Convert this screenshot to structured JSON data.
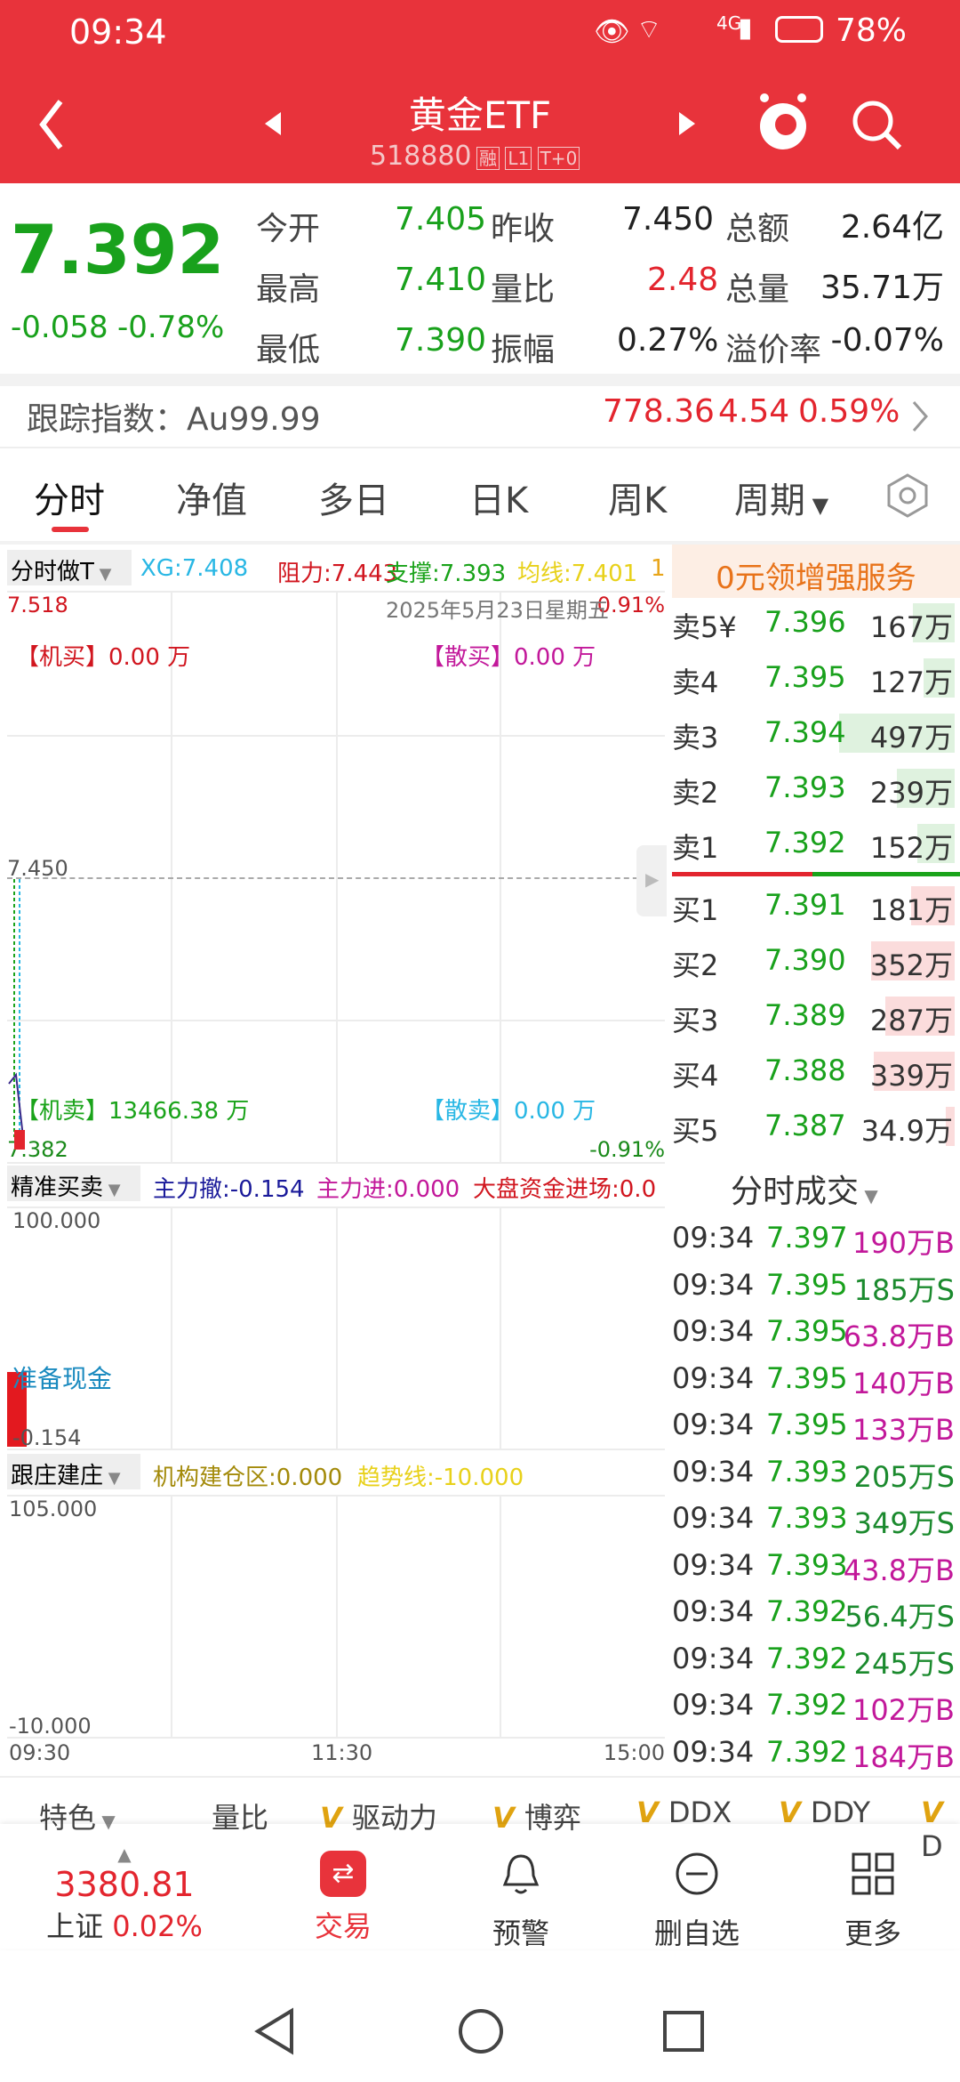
{
  "status": {
    "time": "09:34",
    "battery": "78%",
    "network": "4G"
  },
  "header": {
    "title": "黄金ETF",
    "code": "518880",
    "badges": [
      "融",
      "L1",
      "T+0"
    ]
  },
  "quote": {
    "price": "7.392",
    "change": "-0.058",
    "change_pct": "-0.78%",
    "open_label": "今开",
    "open": "7.405",
    "prev_label": "昨收",
    "prev": "7.450",
    "amount_label": "总额",
    "amount": "2.64亿",
    "high_label": "最高",
    "high": "7.410",
    "vr_label": "量比",
    "vr": "2.48",
    "vol_label": "总量",
    "vol": "35.71万",
    "low_label": "最低",
    "low": "7.390",
    "amp_label": "振幅",
    "amp": "0.27%",
    "prem_label": "溢价率",
    "prem": "-0.07%"
  },
  "track": {
    "label": "跟踪指数：Au99.99",
    "value": "778.36",
    "chg": "4.54",
    "pct": "0.59%"
  },
  "tabs": [
    "分时",
    "净值",
    "多日",
    "日K",
    "周K",
    "周期"
  ],
  "chart1": {
    "mode": "分时做T",
    "xg": "XG:7.408",
    "resist": "阻力:7.443",
    "support": "支撑:7.393",
    "avg": "均线:7.401",
    "extra": "1",
    "top": "7.518",
    "top_pct": "0.91%",
    "mid": "7.450",
    "bottom": "7.382",
    "bottom_pct": "-0.91%",
    "date": "2025年5月23日星期五",
    "inst_buy": "【机买】0.00 万",
    "ret_buy": "【散买】0.00 万",
    "inst_sell": "【机卖】13466.38 万",
    "ret_sell": "【散卖】0.00 万"
  },
  "chart2": {
    "mode": "精准买卖",
    "a": "主力撤:-0.154",
    "b": "主力进:0.000",
    "c": "大盘资金进场:0.0",
    "top": "100.000",
    "bottom": "-0.154",
    "note": "准备现金"
  },
  "chart3": {
    "mode": "跟庄建庄",
    "a": "机构建仓区:0.000",
    "b": "趋势线:-10.000",
    "top": "105.000",
    "bottom": "-10.000",
    "times": [
      "09:30",
      "11:30",
      "15:00"
    ]
  },
  "promo": "0元领增强服务",
  "orderbook": {
    "asks": [
      {
        "label": "卖5¥",
        "price": "7.396",
        "vol": "167万",
        "fill": 0.36
      },
      {
        "label": "卖4",
        "price": "7.395",
        "vol": "127万",
        "fill": 0.27
      },
      {
        "label": "卖3",
        "price": "7.394",
        "vol": "497万",
        "fill": 1.0
      },
      {
        "label": "卖2",
        "price": "7.393",
        "vol": "239万",
        "fill": 0.5
      },
      {
        "label": "卖1",
        "price": "7.392",
        "vol": "152万",
        "fill": 0.32
      }
    ],
    "bids": [
      {
        "label": "买1",
        "price": "7.391",
        "vol": "181万",
        "fill": 0.38
      },
      {
        "label": "买2",
        "price": "7.390",
        "vol": "352万",
        "fill": 0.72
      },
      {
        "label": "买3",
        "price": "7.389",
        "vol": "287万",
        "fill": 0.6
      },
      {
        "label": "买4",
        "price": "7.388",
        "vol": "339万",
        "fill": 0.7
      },
      {
        "label": "买5",
        "price": "7.387",
        "vol": "34.9万",
        "fill": 0.08
      }
    ]
  },
  "ticks_title": "分时成交",
  "ticks": [
    {
      "time": "09:34",
      "price": "7.397",
      "vol": "190万B",
      "side": "B"
    },
    {
      "time": "09:34",
      "price": "7.395",
      "vol": "185万S",
      "side": "S"
    },
    {
      "time": "09:34",
      "price": "7.395",
      "vol": "63.8万B",
      "side": "B"
    },
    {
      "time": "09:34",
      "price": "7.395",
      "vol": "140万B",
      "side": "B"
    },
    {
      "time": "09:34",
      "price": "7.395",
      "vol": "133万B",
      "side": "B"
    },
    {
      "time": "09:34",
      "price": "7.393",
      "vol": "205万S",
      "side": "S"
    },
    {
      "time": "09:34",
      "price": "7.393",
      "vol": "349万S",
      "side": "S"
    },
    {
      "time": "09:34",
      "price": "7.393",
      "vol": "43.8万B",
      "side": "B"
    },
    {
      "time": "09:34",
      "price": "7.392",
      "vol": "56.4万S",
      "side": "S"
    },
    {
      "time": "09:34",
      "price": "7.392",
      "vol": "245万S",
      "side": "S"
    },
    {
      "time": "09:34",
      "price": "7.392",
      "vol": "102万B",
      "side": "B"
    },
    {
      "time": "09:34",
      "price": "7.392",
      "vol": "184万B",
      "side": "B"
    }
  ],
  "indicators": [
    "特色",
    "量比",
    "驱动力",
    "博弈",
    "DDX",
    "DDY",
    "D"
  ],
  "bottom_nav": {
    "index_value": "3380.81",
    "index_name": "上证",
    "index_pct": "0.02%",
    "items": [
      "交易",
      "预警",
      "删自选",
      "更多"
    ]
  },
  "colors": {
    "brand": "#e8333b",
    "down": "#19a11c",
    "up": "#e3252e",
    "buy": "#c2189a",
    "sell": "#1b8a2e"
  }
}
